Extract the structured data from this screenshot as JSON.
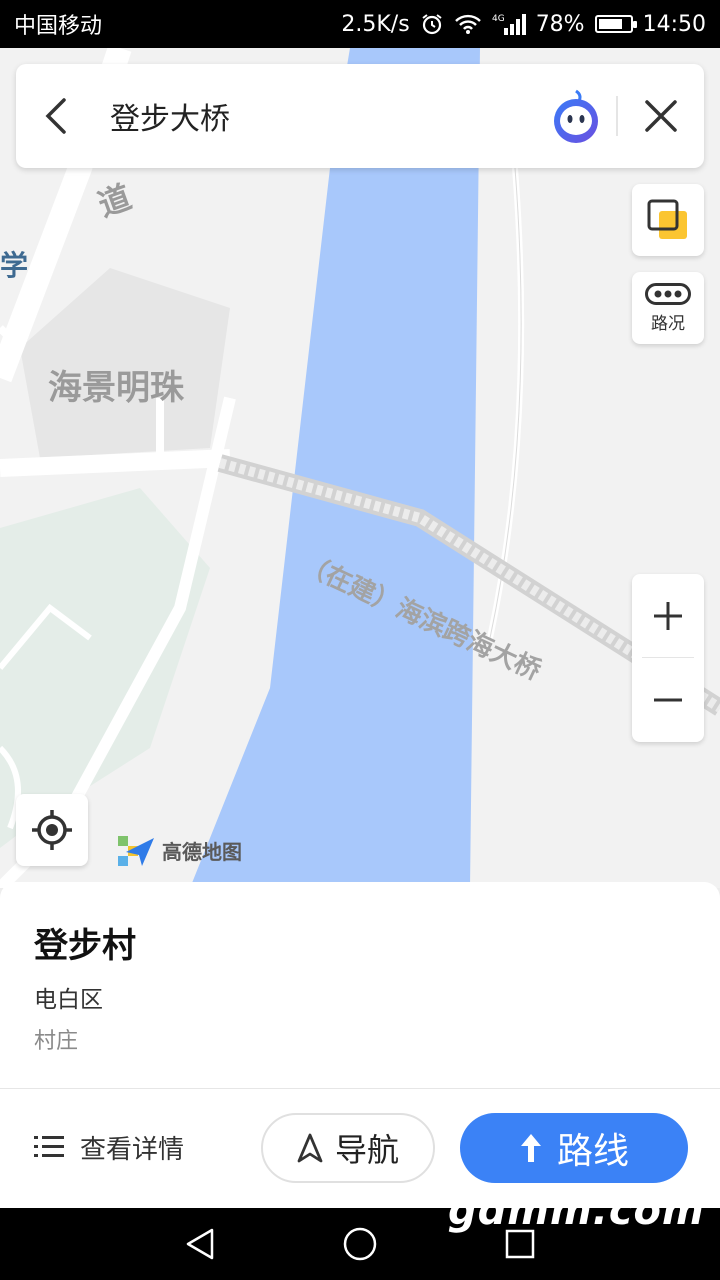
{
  "status_bar": {
    "carrier": "中国移动",
    "speed": "2.5K/s",
    "network": "4G",
    "battery": "78%",
    "battery_level": 0.78,
    "time": "14:50"
  },
  "search": {
    "query": "登步大桥"
  },
  "map": {
    "labels": {
      "road": "道",
      "school": "学",
      "residential": "海景明珠",
      "bridge": "（在建）海滨跨海大桥"
    },
    "traffic_label": "路况",
    "logo_text": "高德地图",
    "colors": {
      "water": "#a8c8fb",
      "land": "#f2f2f2",
      "green": "#e4ede8",
      "block": "#e6e6e6"
    }
  },
  "place": {
    "name": "登步村",
    "district": "电白区",
    "type": "村庄"
  },
  "actions": {
    "details": "查看详情",
    "navigate": "导航",
    "route": "路线"
  },
  "accent_color": "#3b82f6",
  "watermark": "gdmm.com"
}
